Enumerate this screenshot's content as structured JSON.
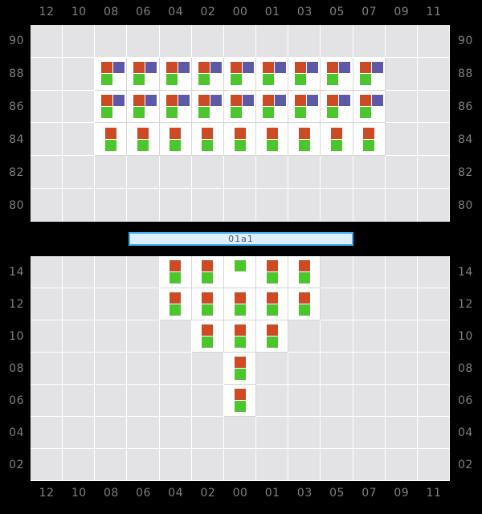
{
  "colors": {
    "background": "#000000",
    "cell_empty": "#e3e3e6",
    "cell_filled": "#ffffff",
    "marker_orange": "#cc4b24",
    "marker_purple": "#5b59a8",
    "marker_green": "#4cc62c",
    "axis_text": "#7f7f86",
    "label_bar_fill": "#ddeeff",
    "label_bar_border": "#3cb0f0",
    "label_bar_text": "#55555c"
  },
  "center_label": {
    "text": "01a1"
  },
  "x_axis": {
    "ticks": [
      "12",
      "10",
      "08",
      "06",
      "04",
      "02",
      "00",
      "01",
      "03",
      "05",
      "07",
      "09",
      "11"
    ]
  },
  "chart_data": {
    "type": "heatmap",
    "title": "",
    "xlabel": "",
    "ylabel": "",
    "grid": true,
    "legend": "none",
    "annotations": [
      "01a1"
    ],
    "x": [
      "12",
      "10",
      "08",
      "06",
      "04",
      "02",
      "00",
      "01",
      "03",
      "05",
      "07",
      "09",
      "11"
    ],
    "panels": [
      {
        "name": "top-panel",
        "y_ticks": [
          "90",
          "88",
          "86",
          "84",
          "82",
          "80"
        ],
        "ylim": [
          79,
          91
        ],
        "rows": [
          {
            "y": "90",
            "cells": [
              "",
              "",
              "",
              "",
              "",
              "",
              "",
              "",
              "",
              "",
              "",
              "",
              ""
            ]
          },
          {
            "y": "88",
            "cells": [
              "",
              "",
              "OPG",
              "OPG",
              "OPG",
              "OPG",
              "OPG",
              "OPG",
              "OPG",
              "OPG",
              "OPG",
              "",
              ""
            ]
          },
          {
            "y": "86",
            "cells": [
              "",
              "",
              "OPG",
              "OPG",
              "OPG",
              "OPG",
              "OPG",
              "OPG",
              "OPG",
              "OPG",
              "OPG",
              "",
              ""
            ]
          },
          {
            "y": "84",
            "cells": [
              "",
              "",
              "OG",
              "OG",
              "OG",
              "OG",
              "OG",
              "OG",
              "OG",
              "OG",
              "OG",
              "",
              ""
            ]
          },
          {
            "y": "82",
            "cells": [
              "",
              "",
              "",
              "",
              "",
              "",
              "",
              "",
              "",
              "",
              "",
              "",
              ""
            ]
          },
          {
            "y": "80",
            "cells": [
              "",
              "",
              "",
              "",
              "",
              "",
              "",
              "",
              "",
              "",
              "",
              "",
              ""
            ]
          }
        ]
      },
      {
        "name": "bottom-panel",
        "y_ticks": [
          "14",
          "12",
          "10",
          "08",
          "06",
          "04",
          "02"
        ],
        "ylim": [
          1,
          15
        ],
        "rows": [
          {
            "y": "14",
            "cells": [
              "",
              "",
              "",
              "",
              "OG",
              "OG",
              "G",
              "OG",
              "OG",
              "",
              "",
              "",
              ""
            ]
          },
          {
            "y": "12",
            "cells": [
              "",
              "",
              "",
              "",
              "OG",
              "OG",
              "OG",
              "OG",
              "OG",
              "",
              "",
              "",
              ""
            ]
          },
          {
            "y": "10",
            "cells": [
              "",
              "",
              "",
              "",
              "",
              "OG",
              "OG",
              "OG",
              "",
              "",
              "",
              "",
              ""
            ]
          },
          {
            "y": "08",
            "cells": [
              "",
              "",
              "",
              "",
              "",
              "",
              "OG",
              "",
              "",
              "",
              "",
              "",
              ""
            ]
          },
          {
            "y": "06",
            "cells": [
              "",
              "",
              "",
              "",
              "",
              "",
              "OG",
              "",
              "",
              "",
              "",
              "",
              ""
            ]
          },
          {
            "y": "04",
            "cells": [
              "",
              "",
              "",
              "",
              "",
              "",
              "",
              "",
              "",
              "",
              "",
              "",
              ""
            ]
          },
          {
            "y": "02",
            "cells": [
              "",
              "",
              "",
              "",
              "",
              "",
              "",
              "",
              "",
              "",
              "",
              "",
              ""
            ]
          }
        ]
      }
    ],
    "marker_legend": {
      "O": "orange-square",
      "P": "purple-square",
      "G": "green-square"
    }
  }
}
